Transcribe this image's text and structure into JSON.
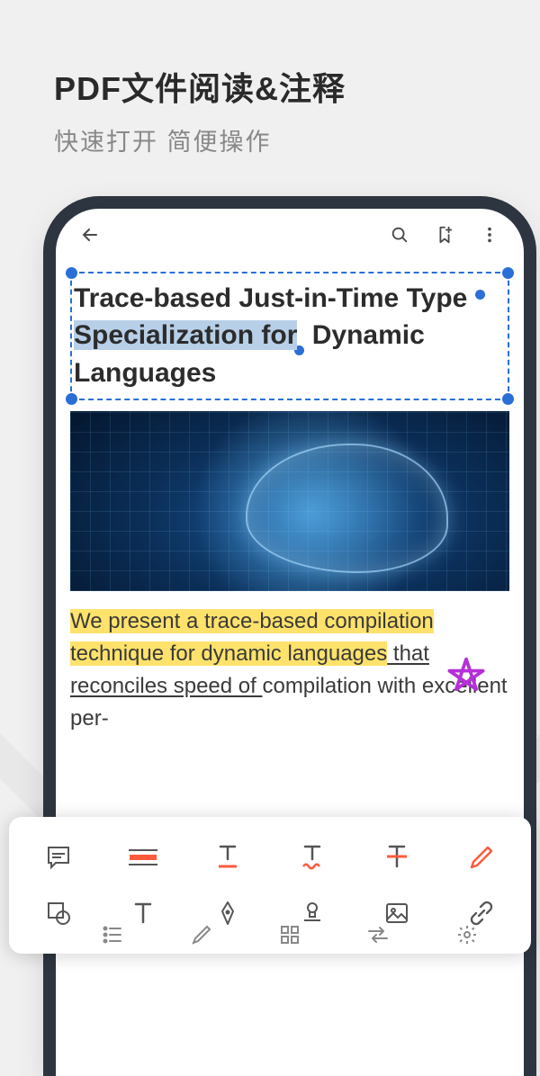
{
  "header": {
    "title": "PDF文件阅读&注释",
    "subtitle": "快速打开 简便操作"
  },
  "doc": {
    "title_before_sel": "Trace-based Just-in-Time Type ",
    "title_sel": "Specialization for",
    "title_after_sel": " Dynamic Languages",
    "body_hl": "We present a trace-based compilation technique for dynamic languages",
    "body_ul": " that reconciles speed of ",
    "body_plain": "compilation with excellent per-"
  },
  "icons": {
    "back": "back-icon",
    "search": "search-icon",
    "bookmark": "bookmark-add-icon",
    "more": "more-vert-icon",
    "comment": "comment-icon",
    "highlight": "highlight-icon",
    "underline": "underline-icon",
    "squiggly": "squiggly-icon",
    "strike": "strikethrough-icon",
    "pencil": "pencil-icon",
    "shape": "shape-icon",
    "text": "text-tool-icon",
    "ink": "ink-pen-icon",
    "stamp": "stamp-icon",
    "image": "image-icon",
    "link": "link-icon",
    "outline": "outline-icon",
    "eraser": "eraser-icon",
    "grid": "grid-view-icon",
    "undo": "undo-redo-icon",
    "settings": "settings-icon"
  }
}
